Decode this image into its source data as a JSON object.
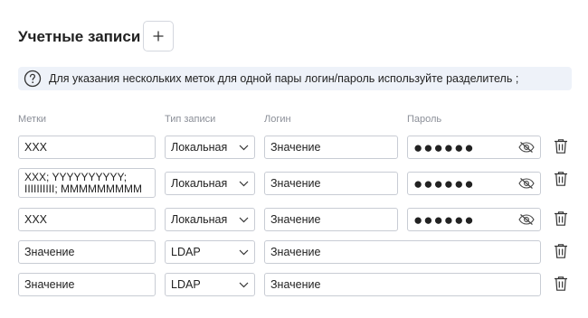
{
  "page": {
    "title": "Учетные записи"
  },
  "info": {
    "text": "Для указания нескольких меток для одной пары логин/пароль используйте разделитель ;"
  },
  "columns": {
    "tags": "Метки",
    "type": "Тип записи",
    "login": "Логин",
    "password": "Пароль"
  },
  "rows": [
    {
      "tags": "XXX",
      "type": "Локальная",
      "login": "Значение",
      "password_mask": "●●●●●●"
    },
    {
      "tags": "XXX; YYYYYYYYYY;\nIIIIIIIIII; MMMMMMMMM",
      "type": "Локальная",
      "login": "Значение",
      "password_mask": "●●●●●●"
    },
    {
      "tags": "XXX",
      "type": "Локальная",
      "login": "Значение",
      "password_mask": "●●●●●●"
    },
    {
      "tags": "Значение",
      "type": "LDAP",
      "login": "Значение"
    },
    {
      "tags": "Значение",
      "type": "LDAP",
      "login": "Значение"
    }
  ],
  "icons": {
    "add": "plus-icon",
    "info": "question-circle-icon",
    "select": "chevron-down-icon",
    "toggle_password": "eye-off-icon",
    "delete": "trash-icon"
  }
}
